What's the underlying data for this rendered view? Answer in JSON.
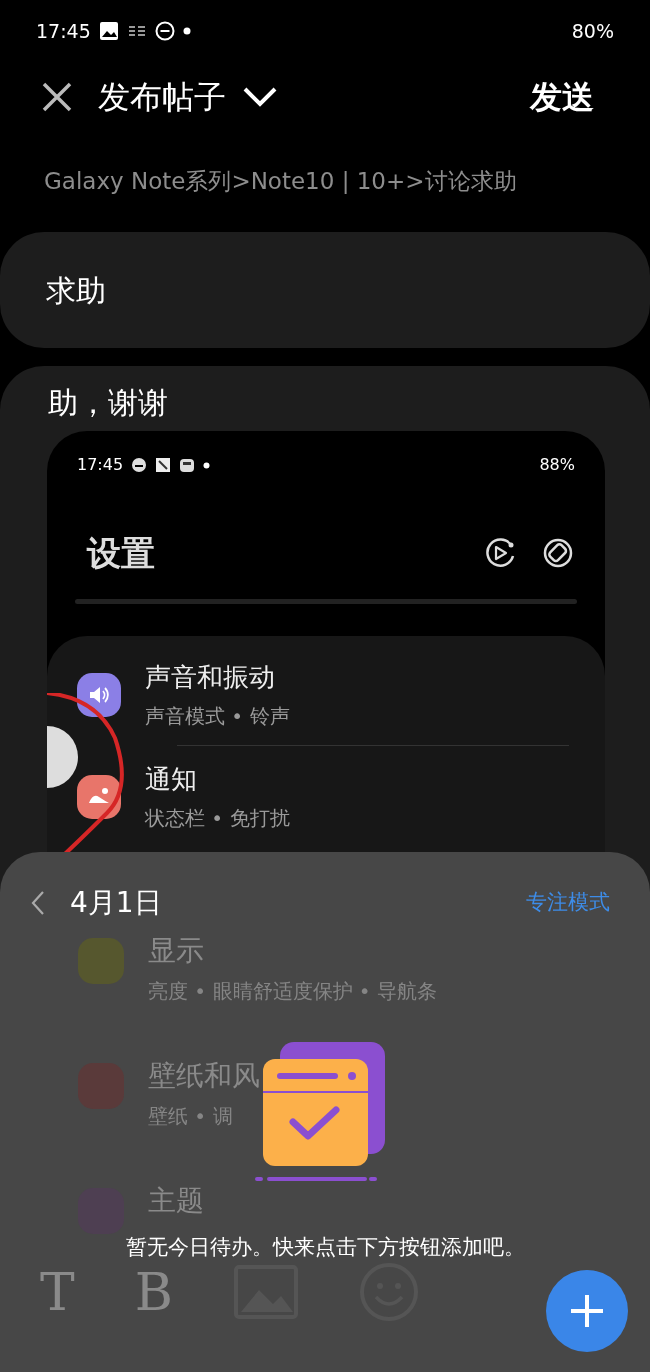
{
  "status_bar": {
    "time": "17:45",
    "battery": "80%"
  },
  "header": {
    "title": "发布帖子",
    "send": "发送"
  },
  "breadcrumb": "Galaxy Note系列>Note10 | 10+>讨论求助",
  "post": {
    "title": "求助",
    "body": "助，谢谢",
    "attachment": {
      "status_bar": {
        "time": "17:45",
        "battery": "88%"
      },
      "title": "设置",
      "items": [
        {
          "title": "声音和振动",
          "subtitle": "声音模式 • 铃声",
          "color": "#8b7fe6",
          "kind": "sound"
        },
        {
          "title": "通知",
          "subtitle": "状态栏 • 免打扰",
          "color": "#e8756a",
          "kind": "notification"
        }
      ]
    }
  },
  "sheet": {
    "date": "4月1日",
    "focus_mode": "专注模式",
    "empty_message": "暂无今日待办。快来点击下方按钮添加吧。",
    "background_items": [
      {
        "title": "显示",
        "subtitle": "亮度 • 眼睛舒适度保护 • 导航条",
        "color": "#56572e"
      },
      {
        "title": "壁纸和风",
        "subtitle": "壁纸 • 调",
        "color": "#5a3a3a"
      },
      {
        "title": "主题",
        "color": "#4e3f52"
      }
    ]
  },
  "toolbar": [
    {
      "kind": "text",
      "label": "T"
    },
    {
      "kind": "text",
      "label": "B"
    },
    {
      "kind": "image"
    },
    {
      "kind": "emoji"
    },
    {
      "kind": "add"
    }
  ]
}
